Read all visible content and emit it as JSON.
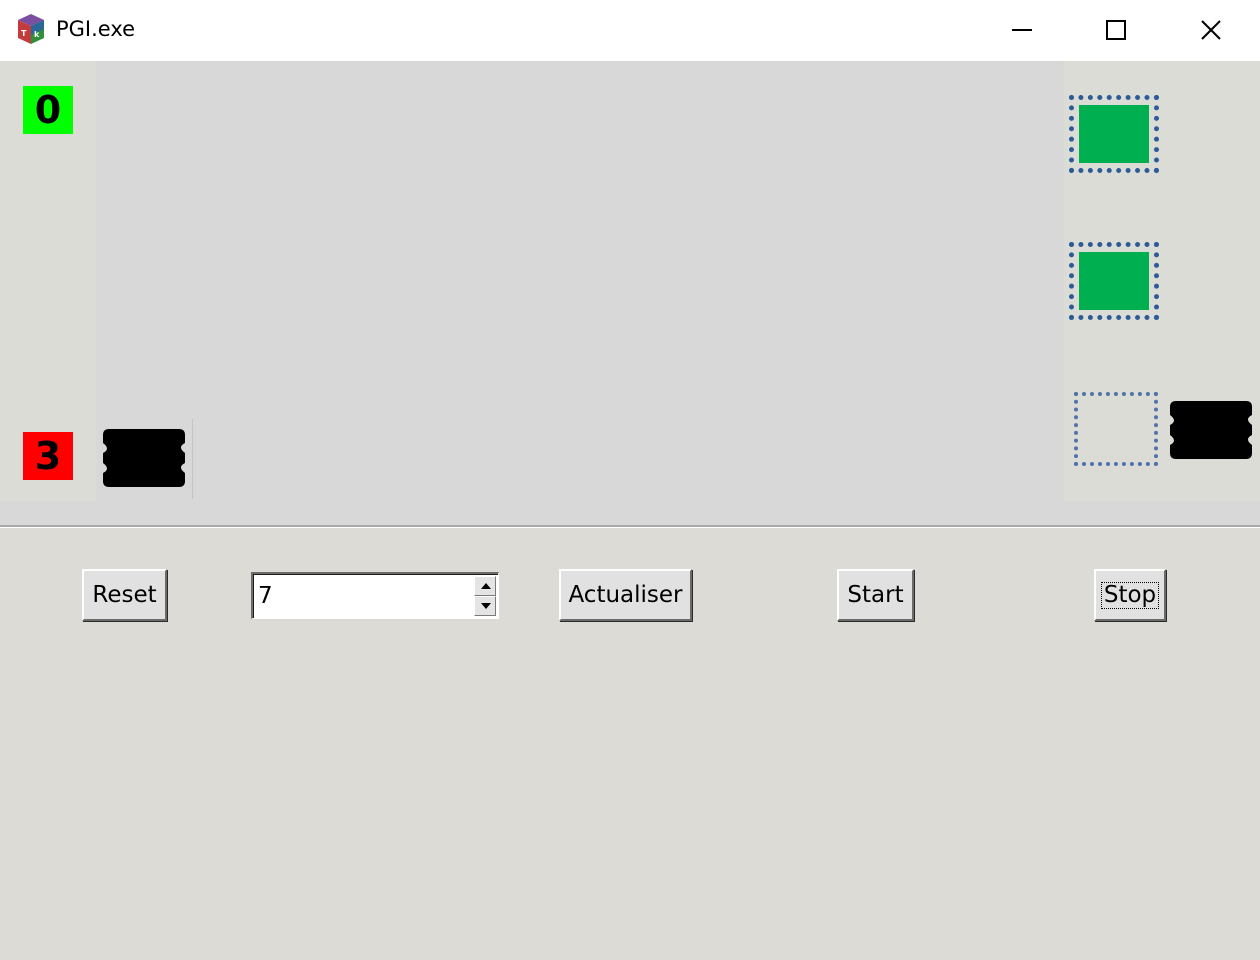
{
  "window": {
    "title": "PGI.exe",
    "icon": "tk-cube-app-icon",
    "controls": {
      "minimize_icon": "minimize-icon",
      "maximize_icon": "maximize-icon",
      "close_icon": "close-icon"
    }
  },
  "canvas": {
    "score_top": {
      "value": "0",
      "color": "#00ff00"
    },
    "score_bottom": {
      "value": "3",
      "color": "#ff0000"
    },
    "slots": [
      {
        "state": "filled",
        "color": "#00b050"
      },
      {
        "state": "filled",
        "color": "#00b050"
      },
      {
        "state": "empty"
      }
    ],
    "cars": [
      "car-icon",
      "car-icon"
    ]
  },
  "controls": {
    "reset_label": "Reset",
    "spin_value": "7",
    "actualiser_label": "Actualiser",
    "start_label": "Start",
    "stop_label": "Stop"
  }
}
